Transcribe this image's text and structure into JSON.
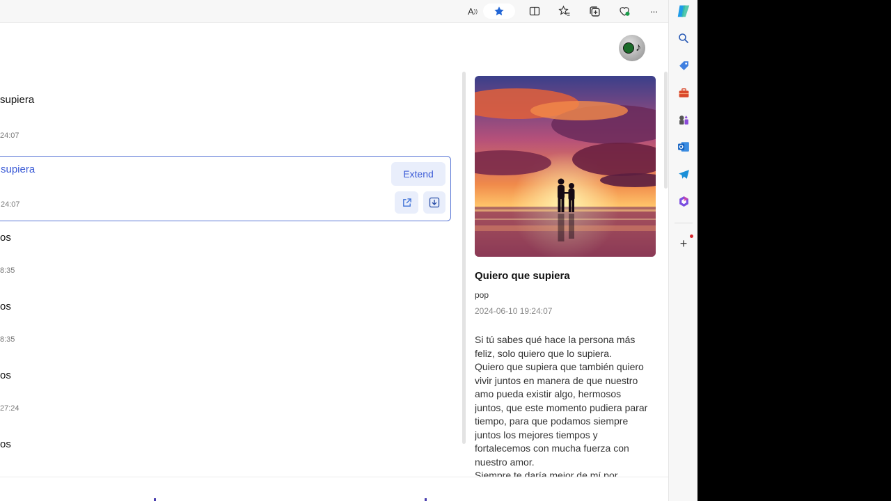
{
  "toolbar": {
    "icons": [
      "read-aloud-icon",
      "favorite-star-icon",
      "split-screen-icon",
      "favorites-icon",
      "collections-icon",
      "browser-essentials-icon",
      "more-icon",
      "copilot-icon"
    ],
    "read_aloud_glyph": "A",
    "more_glyph": "···"
  },
  "sidebar": {
    "icons": [
      "search-icon",
      "shopping-icon",
      "tools-icon",
      "games-icon",
      "outlook-icon",
      "telegram-icon",
      "office-icon",
      "add-icon"
    ],
    "add_glyph": "+"
  },
  "avatar": {
    "glyph": "♪"
  },
  "song_list": {
    "items": [
      {
        "title": "supiera",
        "time": "24:07"
      },
      {
        "title": "supiera",
        "time": "24:07",
        "selected": true
      },
      {
        "title": "os",
        "time": "8:35"
      },
      {
        "title": "os",
        "time": "8:35"
      },
      {
        "title": "os",
        "time": "27:24"
      },
      {
        "title": "os",
        "time": ""
      }
    ],
    "extend_label": "Extend"
  },
  "detail": {
    "title": "Quiero que supiera",
    "genre": "pop",
    "date": "2024-06-10 19:24:07",
    "lyrics": [
      "Si tú sabes qué hace la persona más",
      "feliz, solo quiero que lo supiera.",
      "Quiero que supiera que también quiero",
      "vivir juntos en manera de que nuestro",
      "amo pueda existir algo, hermosos",
      "juntos, que este momento pudiera parar",
      "tiempo, para que podamos siempre",
      "juntos los mejores tiempos y",
      "fortalecemos con mucha fuerza con",
      "nuestro amor.",
      "Siempre te daría mejor de mí por"
    ]
  },
  "colors": {
    "accent": "#3b5bd6",
    "button_bg": "#e9eefb",
    "border_selected": "#5b78d6"
  }
}
